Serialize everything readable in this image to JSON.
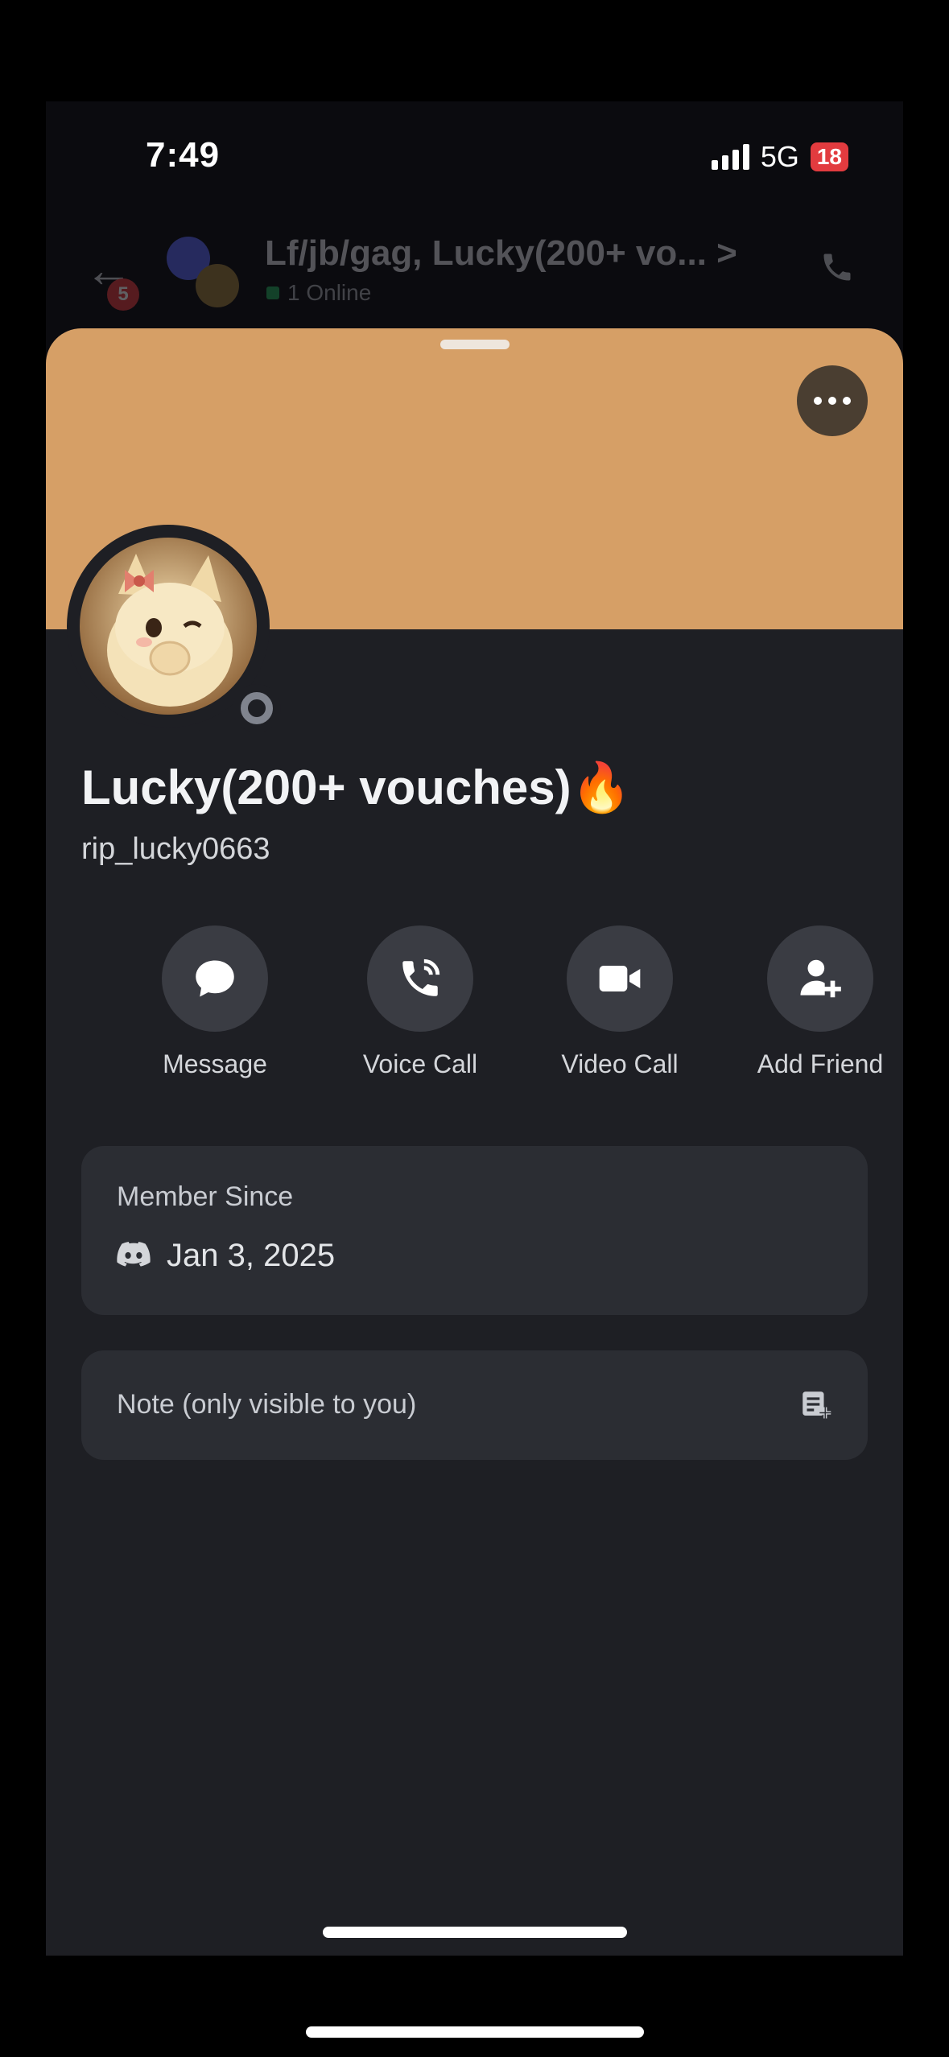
{
  "status_bar": {
    "time": "7:49",
    "network": "5G",
    "battery": "18"
  },
  "chat_header": {
    "title": "Lf/jb/gag, Lucky(200+ vo... >",
    "online": "1 Online",
    "unread_badge": "5"
  },
  "profile": {
    "display_name": "Lucky(200+ vouches)🔥",
    "username": "rip_lucky0663",
    "banner_color": "#d69f66",
    "status": "offline"
  },
  "actions": [
    {
      "label": "Message",
      "icon": "chat-bubble-icon"
    },
    {
      "label": "Voice Call",
      "icon": "phone-call-icon"
    },
    {
      "label": "Video Call",
      "icon": "video-camera-icon"
    },
    {
      "label": "Add Friend",
      "icon": "add-friend-icon"
    }
  ],
  "member_since": {
    "label": "Member Since",
    "date": "Jan 3, 2025",
    "icon": "discord-icon"
  },
  "note": {
    "placeholder": "Note (only visible to you)",
    "icon": "note-edit-icon"
  }
}
